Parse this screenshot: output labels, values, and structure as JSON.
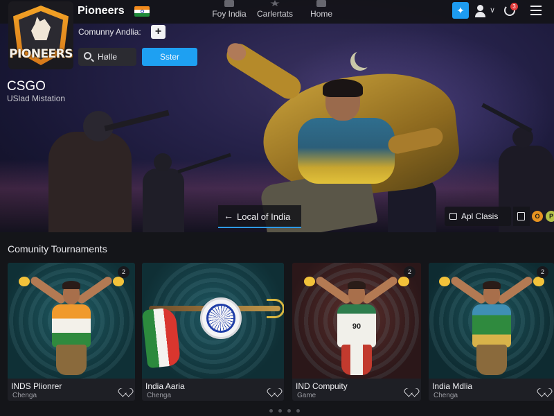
{
  "app": {
    "name": "Pioneers",
    "logo_text": "PIONEERS"
  },
  "nav": {
    "items": [
      {
        "label": "Foy India",
        "icon": "grid-icon"
      },
      {
        "label": "Carlertats",
        "icon": "star-icon"
      },
      {
        "label": "Home",
        "icon": "home-icon"
      }
    ]
  },
  "header_actions": {
    "twitter_icon": "twitter-icon",
    "user_icon": "user-icon",
    "notification_badge": "3",
    "menu_icon": "hamburger-menu-icon"
  },
  "hero": {
    "community_label": "Comunny Andlia:",
    "add_button": "+",
    "search_value": "Hølle",
    "cta_label": "Sster",
    "game_title": "CSGO",
    "game_subtitle": "USlad Mistation",
    "region_tab_label": "Local of India",
    "api_button_label": "Apl Clasis",
    "coins": [
      "O",
      "P"
    ]
  },
  "tournaments": {
    "section_title": "Comunity Tournaments",
    "cards": [
      {
        "title": "INDS Plionrer",
        "subtitle": "Chenga",
        "corner": "2"
      },
      {
        "title": "India Aaria",
        "subtitle": "Chenga",
        "corner": ""
      },
      {
        "title": "IND Compuity",
        "subtitle": "Game",
        "corner": "2",
        "jersey_number": "90"
      },
      {
        "title": "India  Mdlia",
        "subtitle": "Chenga",
        "corner": "2"
      }
    ]
  },
  "pagination": {
    "pages": 4,
    "active": 1
  },
  "colors": {
    "accent_blue": "#1ea0f2",
    "twitter_blue": "#1d9bf0",
    "saffron": "#f28a1c",
    "india_green": "#1f8b3a",
    "background": "#141519"
  }
}
